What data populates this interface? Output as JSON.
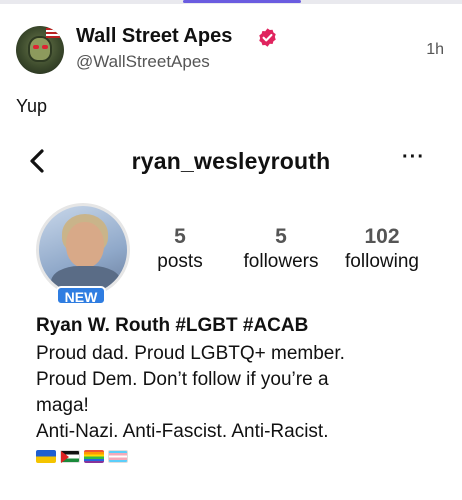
{
  "post": {
    "author_name": "Wall Street Apes",
    "author_handle": "@WallStreetApes",
    "timestamp": "1h",
    "text": "Yup"
  },
  "embed": {
    "username": "ryan_wesleyrouth",
    "more_label": "···",
    "badge": "NEW",
    "stats": {
      "posts": {
        "value": "5",
        "label": "posts"
      },
      "followers": {
        "value": "5",
        "label": "followers"
      },
      "following": {
        "value": "102",
        "label": "following"
      }
    },
    "bio": {
      "name": "Ryan W. Routh #LGBT #ACAB",
      "lines": [
        "Proud dad. Proud LGBTQ+ member.",
        "Proud Dem. Don’t follow if you’re a",
        "maga!",
        "Anti-Nazi. Anti-Fascist. Anti-Racist."
      ],
      "flag_icons": [
        "ukraine-flag-icon",
        "palestine-flag-icon",
        "pride-flag-icon",
        "trans-flag-icon"
      ]
    }
  },
  "colors": {
    "verified_badge": "#e0245e",
    "new_badge": "#2f7de1",
    "tab_indicator": "#6a5ce0"
  }
}
